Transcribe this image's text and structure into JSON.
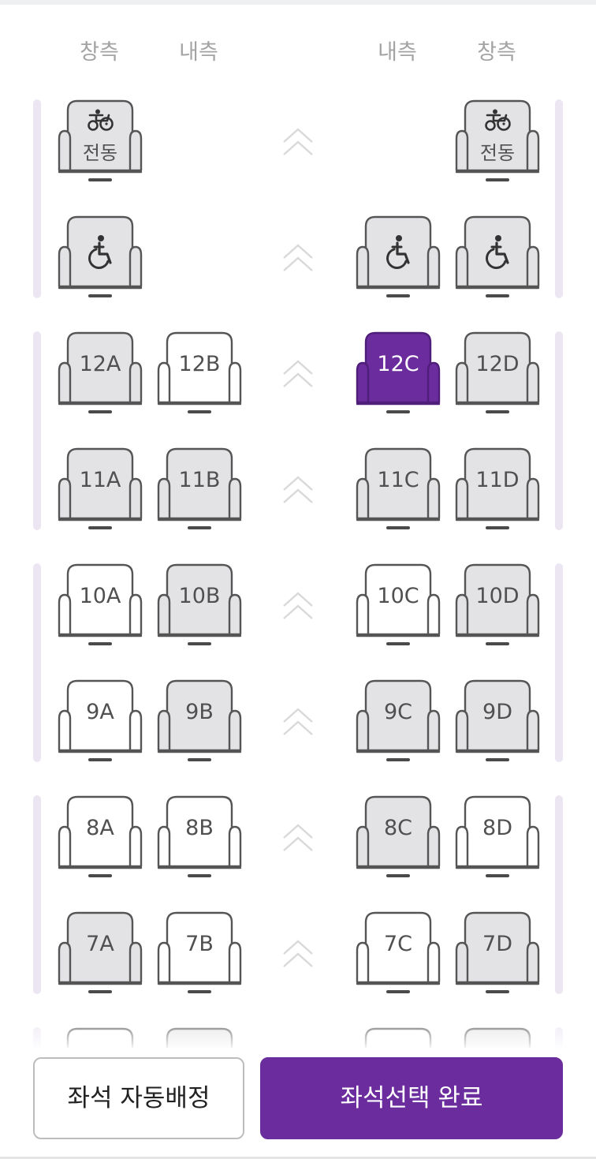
{
  "header": {
    "columns": [
      "창측",
      "내측",
      "내측",
      "창측"
    ]
  },
  "colors": {
    "available": "#ffffff",
    "unavailable": "#e3e3e6",
    "selected": "#6b2c9e",
    "outline": "#555555",
    "rowbar": "#ece6f3",
    "aisle_arrow": "#d9d9d9"
  },
  "seats": [
    {
      "id": "seat-r1-a",
      "label": "전동",
      "icon": "power-wheelchair-icon",
      "state": "unavailable"
    },
    {
      "id": "seat-r1-d",
      "label": "전동",
      "icon": "power-wheelchair-icon",
      "state": "unavailable"
    },
    {
      "id": "seat-r2-a",
      "label": "",
      "icon": "wheelchair-icon",
      "state": "unavailable"
    },
    {
      "id": "seat-r2-c",
      "label": "",
      "icon": "wheelchair-icon",
      "state": "unavailable"
    },
    {
      "id": "seat-r2-d",
      "label": "",
      "icon": "wheelchair-icon",
      "state": "unavailable"
    },
    {
      "id": "seat-12a",
      "label": "12A",
      "state": "unavailable"
    },
    {
      "id": "seat-12b",
      "label": "12B",
      "state": "available"
    },
    {
      "id": "seat-12c",
      "label": "12C",
      "state": "selected"
    },
    {
      "id": "seat-12d",
      "label": "12D",
      "state": "unavailable"
    },
    {
      "id": "seat-11a",
      "label": "11A",
      "state": "unavailable"
    },
    {
      "id": "seat-11b",
      "label": "11B",
      "state": "unavailable"
    },
    {
      "id": "seat-11c",
      "label": "11C",
      "state": "unavailable"
    },
    {
      "id": "seat-11d",
      "label": "11D",
      "state": "unavailable"
    },
    {
      "id": "seat-10a",
      "label": "10A",
      "state": "available"
    },
    {
      "id": "seat-10b",
      "label": "10B",
      "state": "unavailable"
    },
    {
      "id": "seat-10c",
      "label": "10C",
      "state": "available"
    },
    {
      "id": "seat-10d",
      "label": "10D",
      "state": "unavailable"
    },
    {
      "id": "seat-9a",
      "label": "9A",
      "state": "available"
    },
    {
      "id": "seat-9b",
      "label": "9B",
      "state": "unavailable"
    },
    {
      "id": "seat-9c",
      "label": "9C",
      "state": "unavailable"
    },
    {
      "id": "seat-9d",
      "label": "9D",
      "state": "unavailable"
    },
    {
      "id": "seat-8a",
      "label": "8A",
      "state": "available"
    },
    {
      "id": "seat-8b",
      "label": "8B",
      "state": "available"
    },
    {
      "id": "seat-8c",
      "label": "8C",
      "state": "unavailable"
    },
    {
      "id": "seat-8d",
      "label": "8D",
      "state": "available"
    },
    {
      "id": "seat-7a",
      "label": "7A",
      "state": "unavailable"
    },
    {
      "id": "seat-7b",
      "label": "7B",
      "state": "available"
    },
    {
      "id": "seat-7c",
      "label": "7C",
      "state": "available"
    },
    {
      "id": "seat-7d",
      "label": "7D",
      "state": "unavailable"
    },
    {
      "id": "seat-6a",
      "label": "",
      "state": "available"
    },
    {
      "id": "seat-6b",
      "label": "",
      "state": "unavailable"
    },
    {
      "id": "seat-6c",
      "label": "",
      "state": "available"
    },
    {
      "id": "seat-6d",
      "label": "",
      "state": "unavailable"
    }
  ],
  "aisle_icon": "double-chevron-up-icon",
  "buttons": {
    "auto_assign": "좌석 자동배정",
    "complete": "좌석선택 완료"
  }
}
